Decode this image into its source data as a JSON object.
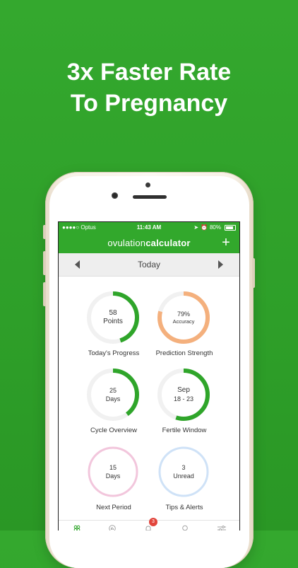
{
  "headline": {
    "line1": "3x Faster Rate",
    "line2": "To Pregnancy"
  },
  "status_bar": {
    "carrier": "●●●●○ Optus",
    "time": "11:43 AM",
    "battery": "80%"
  },
  "app": {
    "logo_part1": "ovulation",
    "logo_part2": "calculator",
    "add_label": "+",
    "date_title": "Today"
  },
  "tiles": [
    {
      "value": "58",
      "unit": "Points",
      "label": "Today's Progress",
      "progress": 0.45,
      "color": "#2fa52a"
    },
    {
      "value": "79%",
      "unit": "Accuracy",
      "label": "Prediction Strength",
      "progress": 0.79,
      "color": "#f4b07d"
    },
    {
      "value": "25",
      "unit": "Days",
      "label": "Cycle Overview",
      "progress": 0.4,
      "color": "#2fa52a"
    },
    {
      "value": "Sep",
      "unit": "18 - 23",
      "label": "Fertile Window",
      "progress": 0.55,
      "color": "#2fa52a"
    },
    {
      "value": "15",
      "unit": "Days",
      "label": "Next Period",
      "progress": 0.0,
      "color": "#f2c6dc"
    },
    {
      "value": "3",
      "unit": "Unread",
      "label": "Tips & Alerts",
      "progress": 0.0,
      "color": "#cfe2f7"
    }
  ],
  "tabbar": {
    "badge": "3",
    "icons": [
      "dashboard-icon",
      "chart-icon",
      "bell-icon",
      "lightbulb-icon",
      "settings-sliders-icon"
    ]
  },
  "colors": {
    "background": "#32a82c",
    "brand": "#32a82c",
    "accuracy": "#f4b07d",
    "badge": "#e2453c"
  }
}
